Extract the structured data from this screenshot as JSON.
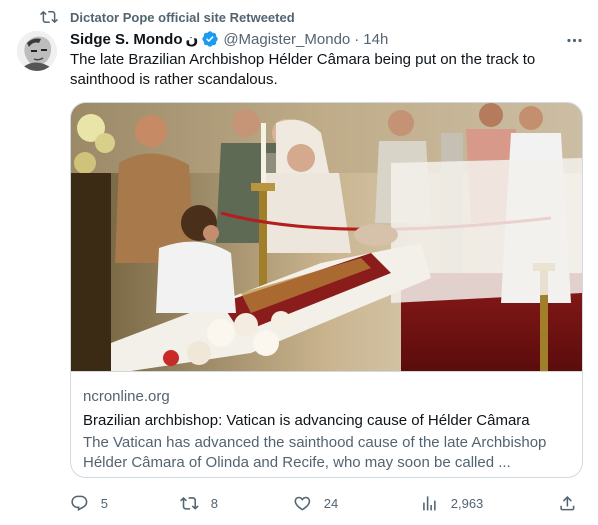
{
  "retweet": {
    "label": "Dictator Pope official site Retweeted",
    "icon": "retweet-icon"
  },
  "author": {
    "display_name": "Sidge S. Mondo",
    "name_glyph": "ن",
    "verified_icon": "verified-badge-icon",
    "handle": "@Magister_Mondo",
    "separator": "·",
    "time": "14h",
    "avatar_icon": "avatar-portrait"
  },
  "more_icon": "more-horizontal-icon",
  "tweet_text": "The late Brazilian Archbishop Hélder Câmara being put on the track to sainthood is rather scandalous.",
  "card": {
    "image_icon": "link-preview-photo",
    "domain": "ncronline.org",
    "title": "Brazilian archbishop: Vatican is advancing cause of Hélder Câmara",
    "description": "The Vatican has advanced the sainthood cause of the late Archbishop Hélder Câmara of Olinda and Recife, who may soon be called ..."
  },
  "actions": {
    "reply_count": "5",
    "retweet_count": "8",
    "like_count": "24",
    "view_count": "2,963",
    "icons": [
      "reply-icon",
      "retweet-icon",
      "like-icon",
      "views-icon",
      "share-icon"
    ]
  },
  "colors": {
    "text_primary": "#0f1419",
    "text_secondary": "#536471",
    "verified_blue": "#1d9bf0",
    "border": "#cfd9de"
  }
}
